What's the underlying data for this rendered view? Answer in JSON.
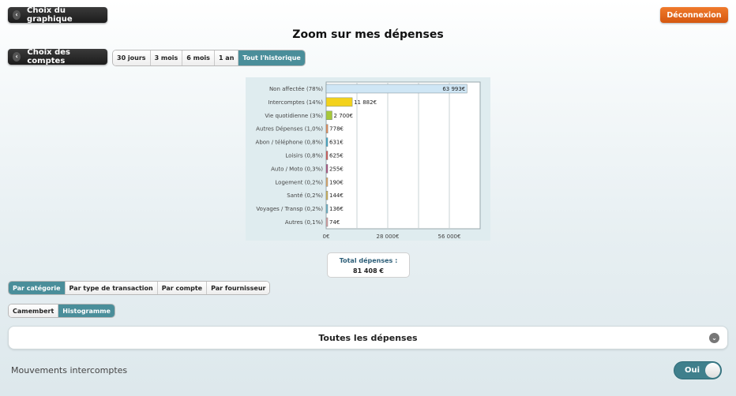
{
  "header": {
    "back_chart_label": "Choix du graphique",
    "logout_label": "Déconnexion",
    "title": "Zoom sur mes dépenses"
  },
  "accounts": {
    "back_accounts_label": "Choix des comptes"
  },
  "periods": [
    {
      "label": "30 jours",
      "active": false
    },
    {
      "label": "3 mois",
      "active": false
    },
    {
      "label": "6 mois",
      "active": false
    },
    {
      "label": "1 an",
      "active": false
    },
    {
      "label": "Tout l'historique",
      "active": true
    }
  ],
  "chart_data": {
    "type": "bar",
    "orientation": "horizontal",
    "categories": [
      "Non affectée (78%)",
      "Intercomptes (14%)",
      "Vie quotidienne (3%)",
      "Autres Dépenses (1,0%)",
      "Abon / téléphone (0,8%)",
      "Loisirs (0,8%)",
      "Auto / Moto (0,3%)",
      "Logement (0,2%)",
      "Santé (0,2%)",
      "Voyages / Transp (0,2%)",
      "Autres (0,1%)"
    ],
    "values": [
      63993,
      11882,
      2700,
      778,
      631,
      625,
      255,
      190,
      144,
      136,
      74
    ],
    "value_labels": [
      "63 993€",
      "11 882€",
      "2 700€",
      "778€",
      "631€",
      "625€",
      "255€",
      "190€",
      "144€",
      "136€",
      "74€"
    ],
    "colors": [
      "#cfe6f5",
      "#f3d21b",
      "#a7c83a",
      "#e58a55",
      "#3aa7c9",
      "#d9534f",
      "#b04a7a",
      "#e8a85f",
      "#d7b24c",
      "#66b2c9",
      "#e0a0a0"
    ],
    "xlim": [
      0,
      70000
    ],
    "x_ticks": [
      0,
      28000,
      56000
    ],
    "x_tick_labels": [
      "0€",
      "28 000€",
      "56 000€"
    ],
    "grid": true,
    "title": "",
    "xlabel": "",
    "ylabel": ""
  },
  "total": {
    "label": "Total dépenses :",
    "value": "81 408 €"
  },
  "groupby": [
    {
      "label": "Par catégorie",
      "active": true
    },
    {
      "label": "Par type de transaction",
      "active": false
    },
    {
      "label": "Par compte",
      "active": false
    },
    {
      "label": "Par fournisseur",
      "active": false
    }
  ],
  "charttype": [
    {
      "label": "Camembert",
      "active": false
    },
    {
      "label": "Histogramme",
      "active": true
    }
  ],
  "filter": {
    "selected": "Toutes les dépenses",
    "icon": "chevron-down-icon"
  },
  "intercomptes": {
    "label": "Mouvements intercomptes",
    "toggle_label": "Oui",
    "on": true
  }
}
